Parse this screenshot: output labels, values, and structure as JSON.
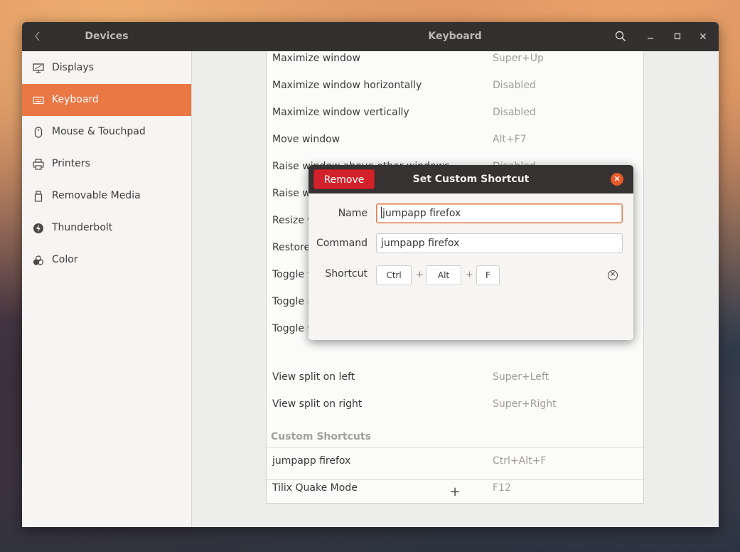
{
  "titlebar": {
    "left_title": "Devices",
    "main_title": "Keyboard"
  },
  "sidebar": {
    "items": [
      {
        "label": "Displays",
        "icon": "display-icon"
      },
      {
        "label": "Keyboard",
        "icon": "keyboard-icon",
        "active": true
      },
      {
        "label": "Mouse & Touchpad",
        "icon": "mouse-icon"
      },
      {
        "label": "Printers",
        "icon": "printer-icon"
      },
      {
        "label": "Removable Media",
        "icon": "removable-media-icon"
      },
      {
        "label": "Thunderbolt",
        "icon": "thunderbolt-icon"
      },
      {
        "label": "Color",
        "icon": "color-icon"
      }
    ]
  },
  "shortcuts": {
    "rows": [
      {
        "name": "Maximize window",
        "accel": "Super+Up"
      },
      {
        "name": "Maximize window horizontally",
        "accel": "Disabled"
      },
      {
        "name": "Maximize window vertically",
        "accel": "Disabled"
      },
      {
        "name": "Move window",
        "accel": "Alt+F7"
      },
      {
        "name": "Raise window above other windows",
        "accel": "Disabled"
      },
      {
        "name": "Raise w",
        "accel": ""
      },
      {
        "name": "Resize w",
        "accel": ""
      },
      {
        "name": "Restore",
        "accel": ""
      },
      {
        "name": "Toggle f",
        "accel": ""
      },
      {
        "name": "Toggle m",
        "accel": ""
      },
      {
        "name": "Toggle w",
        "accel": ""
      },
      {
        "name": "View split on left",
        "accel": "Super+Left"
      },
      {
        "name": "View split on right",
        "accel": "Super+Right"
      }
    ],
    "custom_header": "Custom Shortcuts",
    "custom_rows": [
      {
        "name": "jumpapp firefox",
        "accel": "Ctrl+Alt+F"
      },
      {
        "name": "Tilix Quake Mode",
        "accel": "F12"
      }
    ],
    "add_label": "+"
  },
  "dialog": {
    "remove_label": "Remove",
    "title": "Set Custom Shortcut",
    "name_label": "Name",
    "name_value": "jumpapp firefox",
    "command_label": "Command",
    "command_value": "jumpapp firefox",
    "shortcut_label": "Shortcut",
    "keys": [
      "Ctrl",
      "Alt",
      "F"
    ],
    "plus": "+"
  },
  "colors": {
    "accent": "#ea7845",
    "remove_red": "#d3212b",
    "titlebar": "#333130"
  }
}
